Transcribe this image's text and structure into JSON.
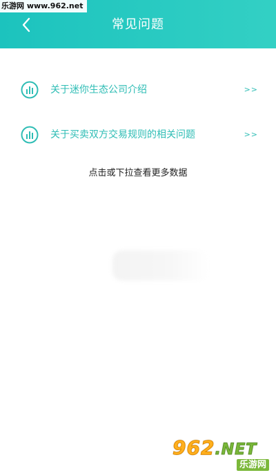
{
  "watermark": {
    "top_text": "乐游网 www.962.net",
    "bottom_logo_num": "962",
    "bottom_logo_suffix": ".NET",
    "bottom_sub": "乐游网"
  },
  "header": {
    "title": "常见问题",
    "back_icon": "chevron-left-icon",
    "background": "#20c6bf"
  },
  "faq": {
    "items": [
      {
        "label": "关于迷你生态公司介绍",
        "arrow": ">>",
        "icon": "bar-chart-circle-icon"
      },
      {
        "label": "关于买卖双方交易规则的相关问题",
        "arrow": ">>",
        "icon": "bar-chart-circle-icon"
      }
    ],
    "accent": "#2fbdb5"
  },
  "load_more": "点击或下拉查看更多数据"
}
